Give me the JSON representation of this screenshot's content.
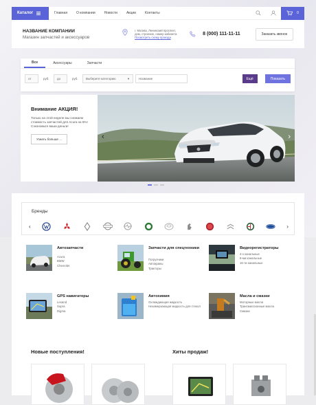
{
  "nav": {
    "catalog": "Каталог",
    "items": [
      "Главная",
      "О компании",
      "Новости",
      "Акции",
      "Контакты"
    ],
    "cart_count": "0"
  },
  "header": {
    "company_name": "НАЗВАНИЕ КОМПАНИИ",
    "company_sub": "Магазин запчастей и аксессуаров",
    "address_line1": "г. Москва, Ленинский проспект,",
    "address_line2": "дом, строение, номер кабинета",
    "map_link": "Посмотреть схему проезда",
    "phone": "8 (000) 111-11-11",
    "callback": "Заказать звонок"
  },
  "search": {
    "tabs": [
      "Все",
      "Аксессуары",
      "Запчасти"
    ],
    "from": "от",
    "currency1": "руб.",
    "to": "до",
    "currency2": "руб.",
    "category": "Выберите категорию",
    "name_placeholder": "Название",
    "small_btn": "Ещё",
    "show_btn": "Показать"
  },
  "banner": {
    "title": "Внимание АКЦИЯ!",
    "desc": "Только на этой неделе мы снижаем стоимость запчастей для Acura на 5%! Сэкономьте ваши деньги!",
    "more": "Узнать больше ..."
  },
  "brands": {
    "title": "Бренды",
    "logos": [
      "volkswagen-logo",
      "mitsubishi-logo",
      "renault-logo",
      "nissan-logo",
      "opel-logo",
      "skoda-logo",
      "toyota-logo",
      "peugeot-logo",
      "fiat-logo",
      "citroen-logo",
      "alfa-romeo-logo",
      "ford-logo"
    ]
  },
  "categories": [
    {
      "title": "Автозапчасти",
      "links": [
        "Acura",
        "BMW",
        "Chevrolet"
      ]
    },
    {
      "title": "Запчасти для спецтехники",
      "links": [
        "Погрузчики",
        "Автокраны",
        "Тракторы"
      ]
    },
    {
      "title": "Видеорегистраторы",
      "links": [
        "4-х канальные",
        "8-ми канальные",
        "16-ти канальные"
      ]
    },
    {
      "title": "GPS навигаторы",
      "links": [
        "Lexand",
        "Supra",
        "Digma"
      ]
    },
    {
      "title": "Автохимия",
      "links": [
        "Охлаждающая жидкость",
        "Незамерзающая жидкость для стекол"
      ]
    },
    {
      "title": "Масла и смазки",
      "links": [
        "Моторные масла",
        "Трансмиссионные масла",
        "Смазки"
      ]
    }
  ],
  "sections": {
    "new": "Новые поступления!",
    "hits": "Хиты продаж!"
  },
  "colors": {
    "accent": "#5a63d8",
    "dark_accent": "#5a3a8a"
  }
}
